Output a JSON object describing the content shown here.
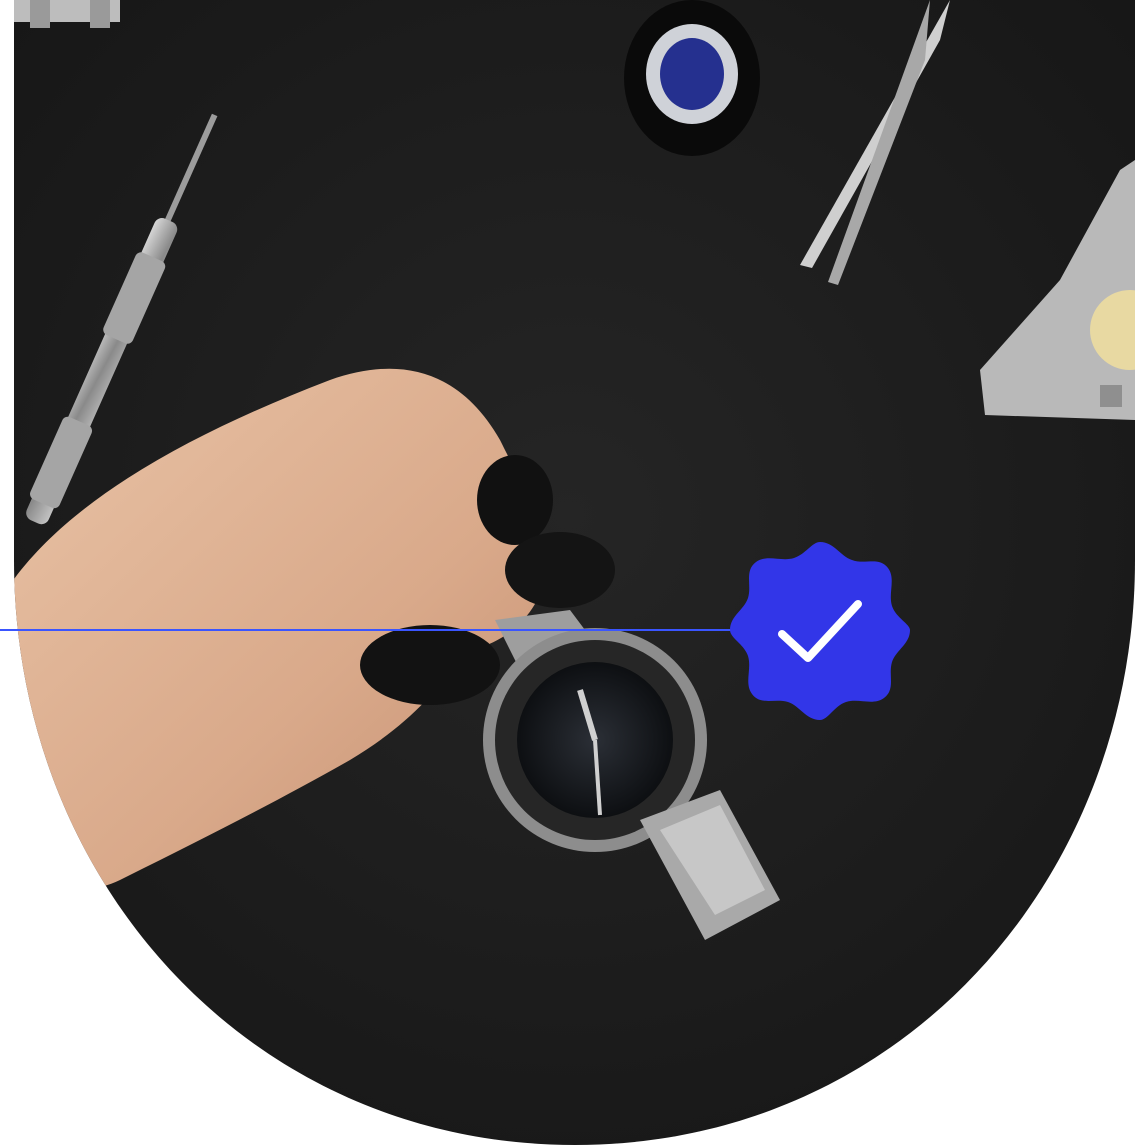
{
  "hero": {
    "image_description_icon": "watch-repair-photo-icon",
    "shape": "rounded-arch"
  },
  "badge": {
    "icon": "check-icon",
    "color": "#3236e8",
    "check_color": "#ffffff"
  },
  "connector": {
    "color": "#3a55ff"
  },
  "colors": {
    "background": "#ffffff",
    "photo_background": "#1f1f1f"
  }
}
